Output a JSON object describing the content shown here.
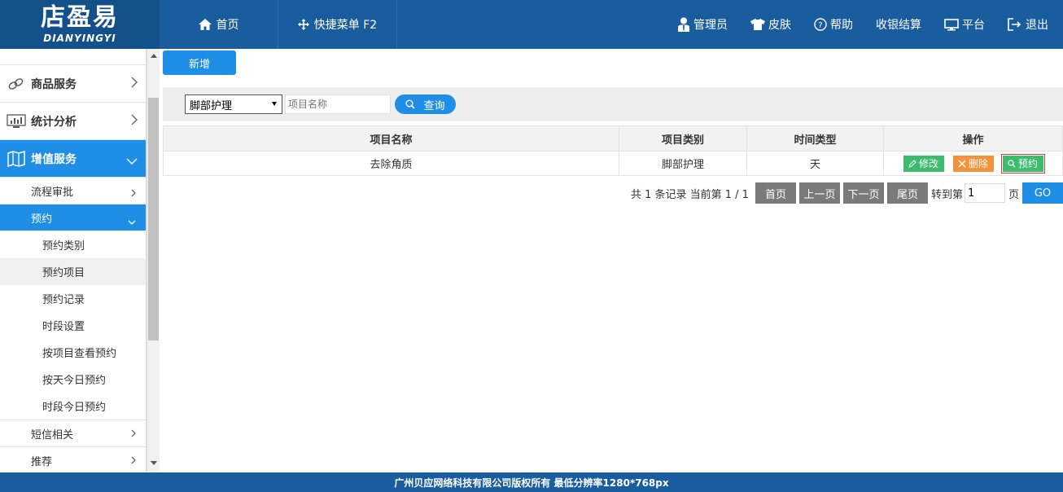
{
  "brand": {
    "name": "店盈易",
    "subtitle": "DIANYINGYI"
  },
  "header": {
    "home": "首页",
    "quick_menu": "快捷菜单 F2",
    "admin": "管理员",
    "skin": "皮肤",
    "help": "帮助",
    "checkout": "收银结算",
    "platform": "平台",
    "logout": "退出"
  },
  "sidebar": {
    "goods": "商品服务",
    "stats": "统计分析",
    "value_added": "增值服务",
    "flow": "流程审批",
    "booking": "预约",
    "booking_items": [
      "预约类别",
      "预约项目",
      "预约记录",
      "时段设置",
      "按项目查看预约",
      "按天今日预约",
      "时段今日预约"
    ],
    "sms": "短信相关",
    "recommend": "推荐"
  },
  "toolbar": {
    "add_label": "新增"
  },
  "search": {
    "category_selected": "脚部护理",
    "name_placeholder": "项目名称",
    "query_label": "查询"
  },
  "table": {
    "columns": [
      "项目名称",
      "项目类别",
      "时间类型",
      "操作"
    ],
    "rows": [
      {
        "name": "去除角质",
        "category": "脚部护理",
        "time_type": "天"
      }
    ],
    "actions": {
      "edit": "修改",
      "delete": "删除",
      "book": "预约"
    }
  },
  "pager": {
    "info": "共 1 条记录 当前第 1 / 1",
    "first": "首页",
    "prev": "上一页",
    "next": "下一页",
    "last": "尾页",
    "goto_label": "转到第",
    "goto_value": "1",
    "page_suffix": "页",
    "go": "GO"
  },
  "footer": {
    "text": "广州贝应网络科技有限公司版权所有 最低分辨率1280*768px"
  },
  "colors": {
    "header": "#1a5d9f",
    "accent": "#1e8ee6",
    "green": "#3dbb6e",
    "orange": "#f5923c",
    "pager_gray": "#7a7a7a"
  }
}
